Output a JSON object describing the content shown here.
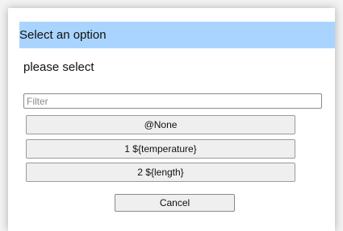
{
  "dialog": {
    "title": "Select an option",
    "prompt": "please select",
    "filter_placeholder": "Filter",
    "filter_value": "",
    "options": [
      {
        "label": "@None"
      },
      {
        "label": "1 ${temperature}"
      },
      {
        "label": "2 ${length}"
      }
    ],
    "cancel_label": "Cancel"
  },
  "colors": {
    "title_bar": "#a9d4ff",
    "button_bg": "#efefef",
    "dialog_bg": "#ffffff"
  }
}
